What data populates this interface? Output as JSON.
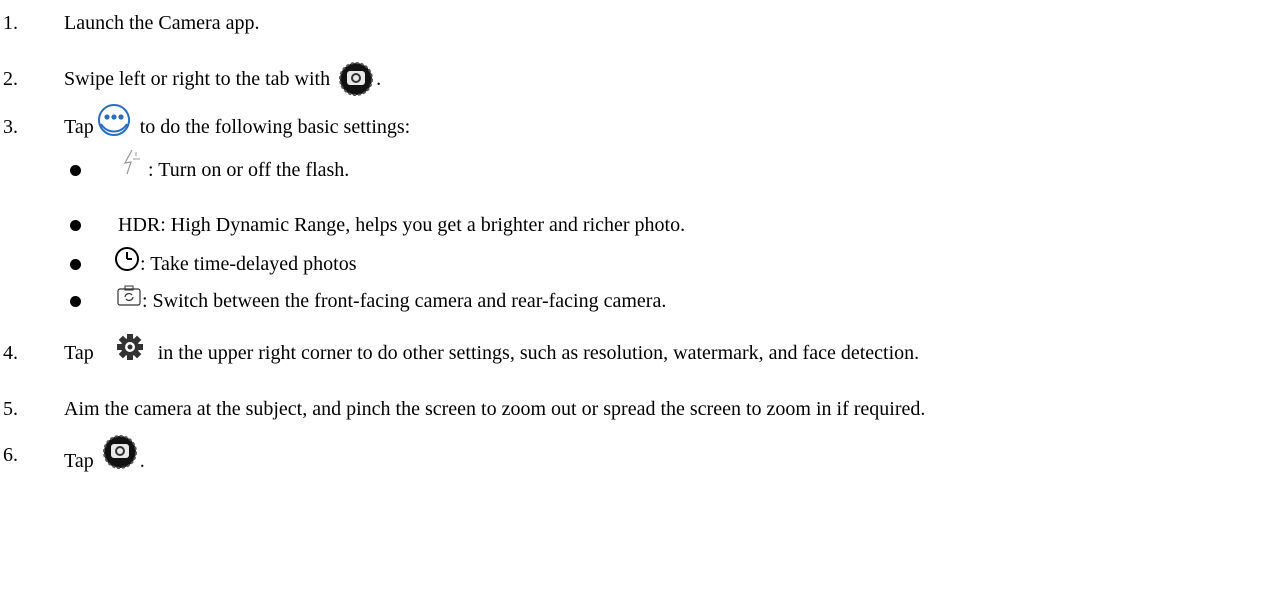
{
  "steps": [
    {
      "number": "1.",
      "text": "Launch the Camera app."
    },
    {
      "number": "2.",
      "before": "Swipe left or right to the tab with",
      "after": ".",
      "icon": "camera-shutter-icon"
    },
    {
      "number": "3.",
      "before": "Tap",
      "after": "to do the following basic settings:",
      "icon": "more-options-icon"
    },
    {
      "number": "4.",
      "before": "Tap",
      "after": "in the upper right corner to do other settings, such as resolution, watermark, and face detection.",
      "icon": "gear-icon"
    },
    {
      "number": "5.",
      "text": "Aim the camera at the subject, and pinch the screen to zoom out or spread the screen to zoom in if required."
    },
    {
      "number": "6.",
      "before": "Tap",
      "after": ".",
      "icon": "camera-shutter-icon"
    }
  ],
  "bullets": [
    {
      "icon": "flash-icon",
      "text": ": Turn on or off the flash."
    },
    {
      "text": "HDR: High Dynamic Range, helps you get a brighter and richer photo."
    },
    {
      "icon": "timer-icon",
      "text": ": Take time-delayed photos"
    },
    {
      "icon": "switch-camera-icon",
      "text": ": Switch between the front-facing camera and rear-facing camera."
    }
  ]
}
